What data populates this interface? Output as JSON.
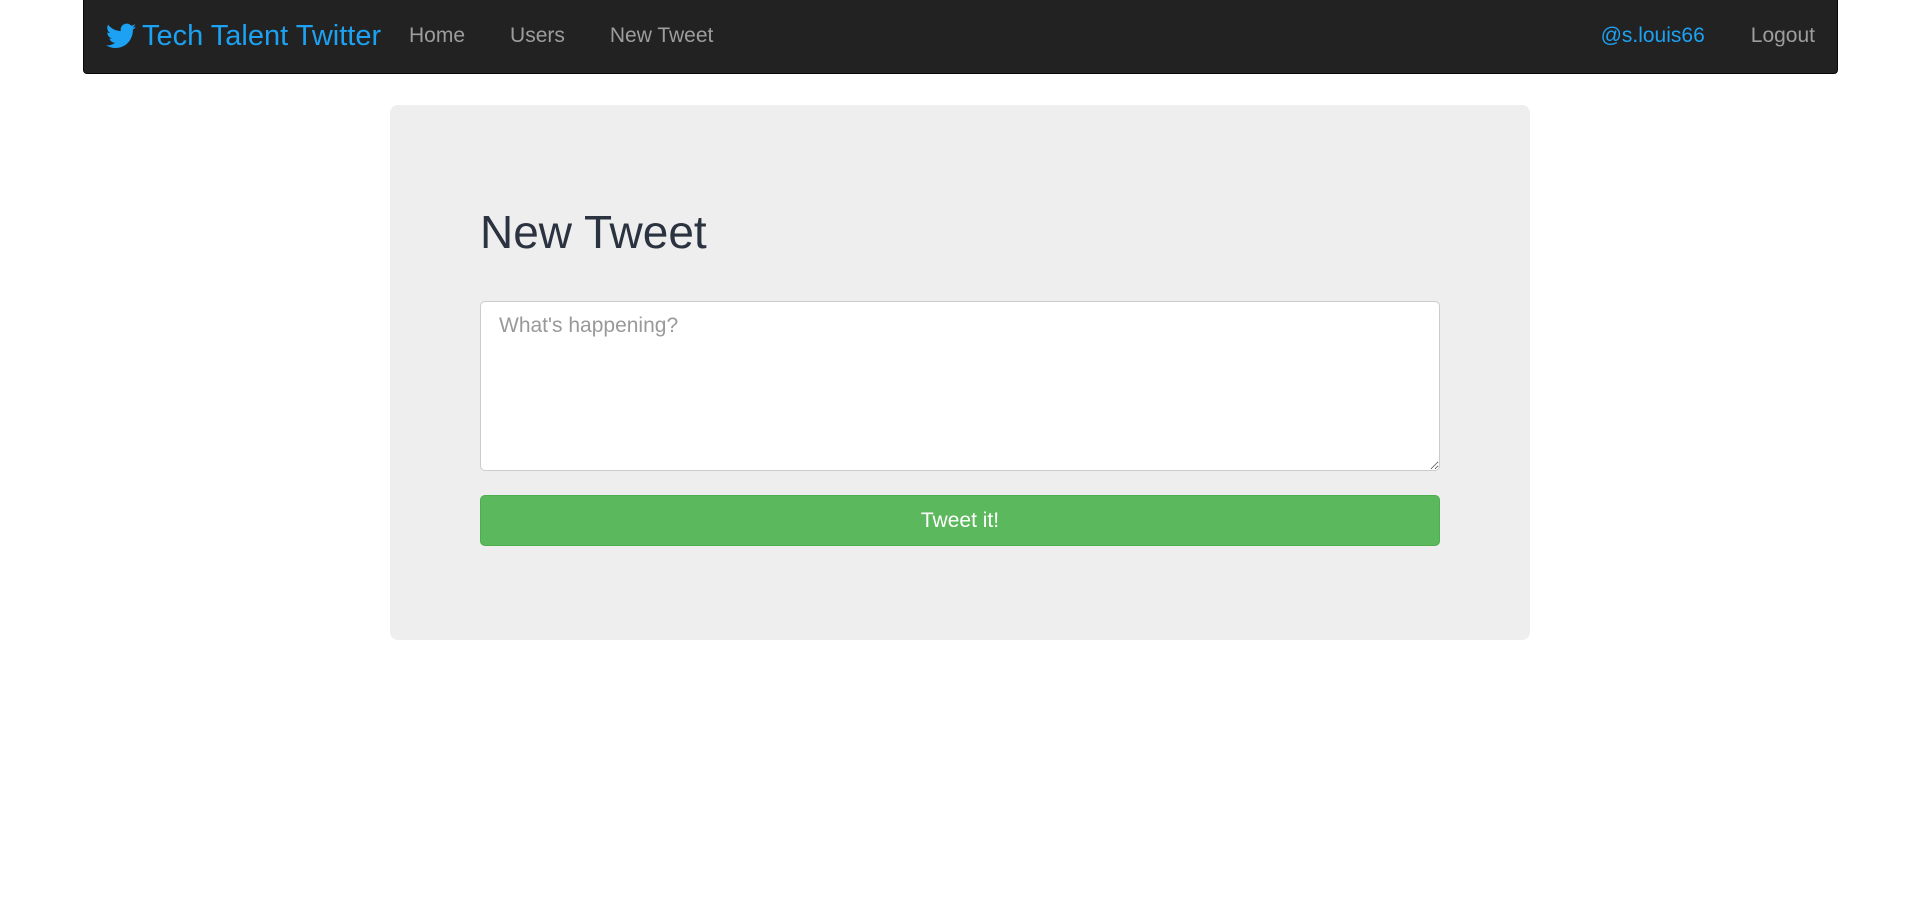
{
  "navbar": {
    "brand_label": "Tech Talent Twitter",
    "brand_icon": "twitter-bird-icon",
    "links": [
      {
        "label": "Home"
      },
      {
        "label": "Users"
      },
      {
        "label": "New Tweet"
      }
    ],
    "user_handle": "@s.louis66",
    "logout_label": "Logout"
  },
  "main": {
    "heading": "New Tweet",
    "tweet_placeholder": "What's happening?",
    "tweet_value": "",
    "submit_label": "Tweet it!"
  },
  "colors": {
    "navbar_bg": "#222222",
    "brand": "#1da1f2",
    "nav_link": "#9d9d9d",
    "panel_bg": "#eeeeee",
    "submit_button": "#5cb85c"
  }
}
